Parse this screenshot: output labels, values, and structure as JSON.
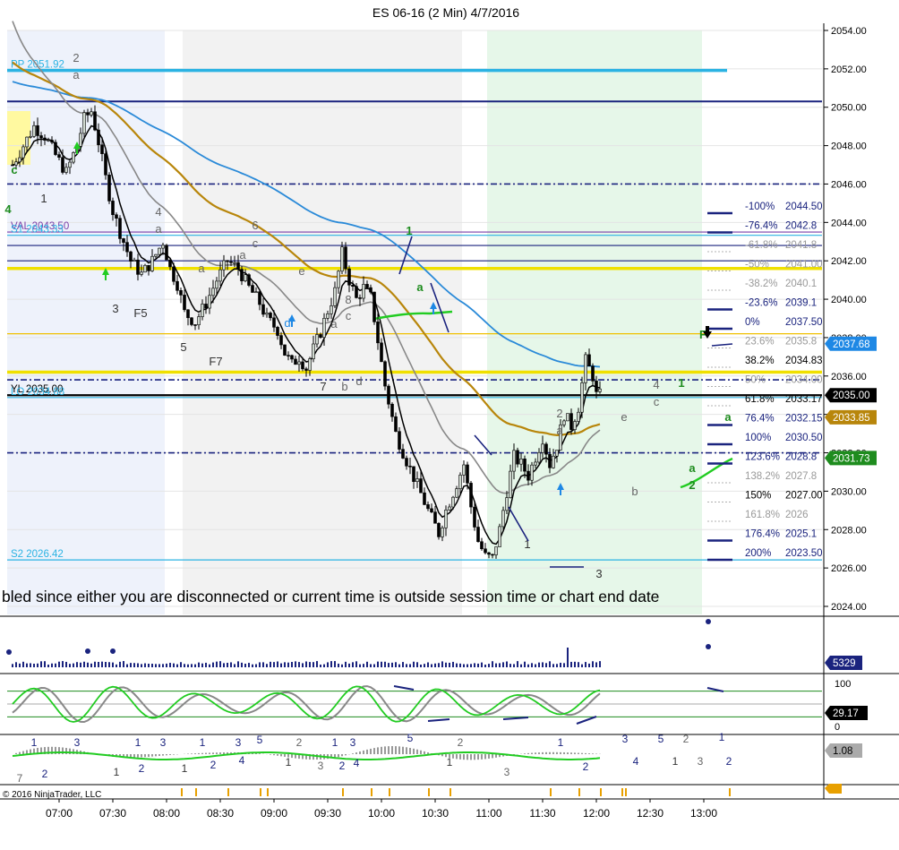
{
  "title": "ES 06-16 (2 Min)  4/7/2016",
  "copyright": "© 2016 NinjaTrader, LLC",
  "warning": "bled since either you are disconnected or current time is outside session time or chart end date",
  "chart_data": [
    {
      "type": "candlestick",
      "name": "price-panel",
      "ylim": [
        2024,
        2054
      ],
      "y_ticks": [
        "2054.00",
        "2052.00",
        "2050.00",
        "2048.00",
        "2046.00",
        "2044.00",
        "2042.00",
        "2040.00",
        "2038.00",
        "2036.00",
        "2034.00",
        "2032.00",
        "2030.00",
        "2028.00",
        "2026.00",
        "2024.00"
      ],
      "x_labels": [
        "07:00",
        "07:30",
        "08:00",
        "08:30",
        "09:00",
        "09:30",
        "10:00",
        "10:30",
        "11:00",
        "11:30",
        "12:00",
        "12:30",
        "13:00"
      ],
      "close_path": [
        [
          0,
          2047.0
        ],
        [
          3,
          2048.0
        ],
        [
          6,
          2049.0
        ],
        [
          9,
          2048.5
        ],
        [
          12,
          2047.5
        ],
        [
          15,
          2046.6
        ],
        [
          18,
          2048.0
        ],
        [
          20,
          2049.4
        ],
        [
          22,
          2049.8
        ],
        [
          24,
          2048.2
        ],
        [
          26,
          2046.3
        ],
        [
          28,
          2044.6
        ],
        [
          30,
          2043.5
        ],
        [
          31,
          2043.0
        ],
        [
          33,
          2042.0
        ],
        [
          36,
          2041.3
        ],
        [
          39,
          2042.0
        ],
        [
          42,
          2043.0
        ],
        [
          44,
          2041.6
        ],
        [
          46,
          2040.8
        ],
        [
          48,
          2039.3
        ],
        [
          51,
          2038.8
        ],
        [
          54,
          2039.8
        ],
        [
          57,
          2041.0
        ],
        [
          60,
          2042.0
        ],
        [
          63,
          2041.6
        ],
        [
          66,
          2040.6
        ],
        [
          69,
          2039.8
        ],
        [
          71,
          2039.0
        ],
        [
          74,
          2038.4
        ],
        [
          76,
          2037.2
        ],
        [
          78,
          2036.6
        ],
        [
          80,
          2037.0
        ],
        [
          82,
          2036.4
        ],
        [
          84,
          2037.4
        ],
        [
          86,
          2038.3
        ],
        [
          88,
          2039.4
        ],
        [
          90,
          2040.4
        ],
        [
          92,
          2042.4
        ],
        [
          94,
          2041.0
        ],
        [
          96,
          2040.0
        ],
        [
          98,
          2040.6
        ],
        [
          100,
          2040.1
        ],
        [
          101,
          2039.0
        ],
        [
          104,
          2035.5
        ],
        [
          107,
          2033.0
        ],
        [
          110,
          2031.6
        ],
        [
          113,
          2030.3
        ],
        [
          116,
          2029.0
        ],
        [
          119,
          2027.8
        ],
        [
          121,
          2029.0
        ],
        [
          124,
          2030.4
        ],
        [
          126,
          2031.4
        ],
        [
          128,
          2029.2
        ],
        [
          130,
          2027.4
        ],
        [
          132,
          2026.6
        ],
        [
          134,
          2026.5
        ],
        [
          136,
          2028.0
        ],
        [
          138,
          2030.0
        ],
        [
          140,
          2031.8
        ],
        [
          142,
          2031.4
        ],
        [
          144,
          2030.8
        ],
        [
          146,
          2031.8
        ],
        [
          148,
          2032.8
        ],
        [
          150,
          2031.4
        ],
        [
          152,
          2032.4
        ],
        [
          154,
          2034.0
        ],
        [
          156,
          2033.4
        ],
        [
          158,
          2034.4
        ],
        [
          160,
          2036.8
        ],
        [
          162,
          2036.0
        ],
        [
          163,
          2035.0
        ]
      ],
      "horizontal_levels": [
        {
          "label": "PP 2051.92",
          "price": 2051.92,
          "color": "#2bb3e3"
        },
        {
          "label": "",
          "price": 2050.3,
          "color": "#1a237e"
        },
        {
          "label": "",
          "price": 2046.0,
          "color": "#1a237e"
        },
        {
          "label": "VAL 2043.50",
          "price": 2043.5,
          "color": "#7b3fa8"
        },
        {
          "label": "S1 2043.33",
          "price": 2043.33,
          "color": "#2bb3e3"
        },
        {
          "label": "",
          "price": 2042.8,
          "color": "#1a237e"
        },
        {
          "label": "",
          "price": 2042.0,
          "color": "#1a237e"
        },
        {
          "label": "",
          "price": 2041.6,
          "color": "#f0e000"
        },
        {
          "label": "",
          "price": 2038.2,
          "color": "#f0c000"
        },
        {
          "label": "",
          "price": 2036.2,
          "color": "#f0e000"
        },
        {
          "label": "",
          "price": 2035.8,
          "color": "#1a237e"
        },
        {
          "label": "YL 2035.00",
          "price": 2035.0,
          "color": "#000000"
        },
        {
          "label": "LO 2034.88",
          "price": 2034.88,
          "color": "#2bb3e3"
        },
        {
          "label": "",
          "price": 2032.0,
          "color": "#1a237e"
        },
        {
          "label": "S2 2026.42",
          "price": 2026.42,
          "color": "#2bb3e3"
        }
      ],
      "fib_levels": [
        {
          "label": "-100%",
          "value": "2044.50",
          "color": "#1a237e"
        },
        {
          "label": "-76.4%",
          "value": "2042.8",
          "color": "#1a237e"
        },
        {
          "label": "-61.8%",
          "value": "2041.8",
          "color": "#999999"
        },
        {
          "label": "-50%",
          "value": "2041.00",
          "color": "#999999"
        },
        {
          "label": "-38.2%",
          "value": "2040.1",
          "color": "#999999"
        },
        {
          "label": "-23.6%",
          "value": "2039.1",
          "color": "#1a237e"
        },
        {
          "label": "0%",
          "value": "2037.50",
          "color": "#1a237e"
        },
        {
          "label": "23.6%",
          "value": "2035.8",
          "color": "#999999"
        },
        {
          "label": "38.2%",
          "value": "2034.83",
          "color": "#000000"
        },
        {
          "label": "50%",
          "value": "2034.00",
          "color": "#999999"
        },
        {
          "label": "61.8%",
          "value": "2033.17",
          "color": "#000000"
        },
        {
          "label": "76.4%",
          "value": "2032.15",
          "color": "#1a237e"
        },
        {
          "label": "100%",
          "value": "2030.50",
          "color": "#1a237e"
        },
        {
          "label": "123.6%",
          "value": "2028.8",
          "color": "#1a237e"
        },
        {
          "label": "138.2%",
          "value": "2027.8",
          "color": "#999999"
        },
        {
          "label": "150%",
          "value": "2027.00",
          "color": "#000000"
        },
        {
          "label": "161.8%",
          "value": "2026",
          "color": "#999999"
        },
        {
          "label": "176.4%",
          "value": "2025.1",
          "color": "#1a237e"
        },
        {
          "label": "200%",
          "value": "2023.50",
          "color": "#1a237e"
        }
      ],
      "price_tags": [
        {
          "label": "2037.68",
          "price": 2037.68,
          "bg": "#1e88e5",
          "fg": "#ffffff"
        },
        {
          "label": "2035.00",
          "price": 2035.0,
          "bg": "#000000",
          "fg": "#ffffff"
        },
        {
          "label": "2033.85",
          "price": 2033.85,
          "bg": "#b8860b",
          "fg": "#ffffff"
        },
        {
          "label": "2031.73",
          "price": 2031.73,
          "bg": "#1e8c1e",
          "fg": "#ffffff"
        }
      ],
      "wave_labels": [
        {
          "text": "2",
          "x": 85,
          "y": 69,
          "color": "#666666"
        },
        {
          "text": "a",
          "x": 85,
          "y": 88,
          "color": "#666666"
        },
        {
          "text": "1",
          "x": 49,
          "y": 226,
          "color": "#333333"
        },
        {
          "text": "c",
          "x": 16,
          "y": 194,
          "color": "#1e8c1e"
        },
        {
          "text": "4",
          "x": 9,
          "y": 238,
          "color": "#1e8c1e"
        },
        {
          "text": "4",
          "x": 177,
          "y": 241,
          "color": "#666666"
        },
        {
          "text": "a",
          "x": 177,
          "y": 260,
          "color": "#666666"
        },
        {
          "text": "3",
          "x": 129,
          "y": 349,
          "color": "#333333"
        },
        {
          "text": "F5",
          "x": 157,
          "y": 354,
          "color": "#333333"
        },
        {
          "text": "a",
          "x": 225,
          "y": 304,
          "color": "#666666"
        },
        {
          "text": "5",
          "x": 205,
          "y": 392,
          "color": "#333333"
        },
        {
          "text": "F7",
          "x": 241,
          "y": 408,
          "color": "#333333"
        },
        {
          "text": "6",
          "x": 285,
          "y": 256,
          "color": "#666666"
        },
        {
          "text": "c",
          "x": 285,
          "y": 276,
          "color": "#666666"
        },
        {
          "text": "a",
          "x": 271,
          "y": 289,
          "color": "#666666"
        },
        {
          "text": "e",
          "x": 337,
          "y": 307,
          "color": "#666666"
        },
        {
          "text": "d",
          "x": 321,
          "y": 365,
          "color": "#1e88e5"
        },
        {
          "text": "8",
          "x": 389,
          "y": 339,
          "color": "#666666"
        },
        {
          "text": "c",
          "x": 389,
          "y": 357,
          "color": "#666666"
        },
        {
          "text": "a",
          "x": 373,
          "y": 366,
          "color": "#666666"
        },
        {
          "text": "7",
          "x": 361,
          "y": 436,
          "color": "#333333"
        },
        {
          "text": "b",
          "x": 385,
          "y": 436,
          "color": "#666666"
        },
        {
          "text": "d",
          "x": 401,
          "y": 430,
          "color": "#666666"
        },
        {
          "text": "1",
          "x": 457,
          "y": 262,
          "color": "#1e8c1e"
        },
        {
          "text": "a",
          "x": 469,
          "y": 325,
          "color": "#1e8c1e"
        },
        {
          "text": "2",
          "x": 625,
          "y": 466,
          "color": "#666666"
        },
        {
          "text": "a",
          "x": 625,
          "y": 485,
          "color": "#666666"
        },
        {
          "text": "1",
          "x": 589,
          "y": 612,
          "color": "#333333"
        },
        {
          "text": "3",
          "x": 669,
          "y": 645,
          "color": "#333333"
        },
        {
          "text": "e",
          "x": 697,
          "y": 470,
          "color": "#666666"
        },
        {
          "text": "4",
          "x": 733,
          "y": 434,
          "color": "#666666"
        },
        {
          "text": "c",
          "x": 733,
          "y": 453,
          "color": "#666666"
        },
        {
          "text": "b",
          "x": 709,
          "y": 553,
          "color": "#666666"
        },
        {
          "text": "1",
          "x": 761,
          "y": 432,
          "color": "#1e8c1e"
        },
        {
          "text": "a",
          "x": 773,
          "y": 527,
          "color": "#1e8c1e"
        },
        {
          "text": "2",
          "x": 773,
          "y": 546,
          "color": "#1e8c1e"
        },
        {
          "text": "F",
          "x": 785,
          "y": 378,
          "color": "#1e8c1e"
        },
        {
          "text": "a",
          "x": 813,
          "y": 470,
          "color": "#1e8c1e"
        }
      ]
    },
    {
      "type": "bar",
      "name": "volume-panel",
      "ylim": [
        0,
        1
      ],
      "current": "5329"
    },
    {
      "type": "line",
      "name": "stochastic-panel",
      "ylim": [
        0,
        100
      ],
      "y_ticks": [
        "100",
        "0"
      ],
      "current": "29.17"
    },
    {
      "type": "bar",
      "name": "macd-panel",
      "current": "1.08",
      "wave_labels": [
        {
          "text": "1",
          "x": 38,
          "y": 833,
          "color": "#1a237e"
        },
        {
          "text": "3",
          "x": 86,
          "y": 833,
          "color": "#1a237e"
        },
        {
          "text": "7",
          "x": 22,
          "y": 873,
          "color": "#666666"
        },
        {
          "text": "2",
          "x": 50,
          "y": 868,
          "color": "#1a237e"
        },
        {
          "text": "1",
          "x": 130,
          "y": 866,
          "color": "#333333"
        },
        {
          "text": "1",
          "x": 154,
          "y": 833,
          "color": "#1a237e"
        },
        {
          "text": "3",
          "x": 182,
          "y": 833,
          "color": "#1a237e"
        },
        {
          "text": "2",
          "x": 158,
          "y": 862,
          "color": "#1a237e"
        },
        {
          "text": "1",
          "x": 206,
          "y": 862,
          "color": "#333333"
        },
        {
          "text": "1",
          "x": 226,
          "y": 833,
          "color": "#1a237e"
        },
        {
          "text": "2",
          "x": 238,
          "y": 858,
          "color": "#1a237e"
        },
        {
          "text": "3",
          "x": 266,
          "y": 833,
          "color": "#1a237e"
        },
        {
          "text": "5",
          "x": 290,
          "y": 830,
          "color": "#1a237e"
        },
        {
          "text": "4",
          "x": 270,
          "y": 853,
          "color": "#1a237e"
        },
        {
          "text": "1",
          "x": 322,
          "y": 855,
          "color": "#333333"
        },
        {
          "text": "2",
          "x": 334,
          "y": 833,
          "color": "#666666"
        },
        {
          "text": "3",
          "x": 358,
          "y": 859,
          "color": "#666666"
        },
        {
          "text": "1",
          "x": 374,
          "y": 833,
          "color": "#1a237e"
        },
        {
          "text": "3",
          "x": 394,
          "y": 833,
          "color": "#1a237e"
        },
        {
          "text": "2",
          "x": 382,
          "y": 859,
          "color": "#1a237e"
        },
        {
          "text": "4",
          "x": 398,
          "y": 856,
          "color": "#1a237e"
        },
        {
          "text": "5",
          "x": 458,
          "y": 828,
          "color": "#1a237e"
        },
        {
          "text": "1",
          "x": 502,
          "y": 855,
          "color": "#333333"
        },
        {
          "text": "2",
          "x": 514,
          "y": 833,
          "color": "#666666"
        },
        {
          "text": "3",
          "x": 566,
          "y": 866,
          "color": "#666666"
        },
        {
          "text": "1",
          "x": 626,
          "y": 833,
          "color": "#1a237e"
        },
        {
          "text": "2",
          "x": 654,
          "y": 860,
          "color": "#1a237e"
        },
        {
          "text": "3",
          "x": 698,
          "y": 829,
          "color": "#1a237e"
        },
        {
          "text": "4",
          "x": 710,
          "y": 854,
          "color": "#1a237e"
        },
        {
          "text": "5",
          "x": 738,
          "y": 829,
          "color": "#1a237e"
        },
        {
          "text": "1",
          "x": 754,
          "y": 854,
          "color": "#333333"
        },
        {
          "text": "2",
          "x": 766,
          "y": 829,
          "color": "#666666"
        },
        {
          "text": "3",
          "x": 782,
          "y": 854,
          "color": "#666666"
        },
        {
          "text": "1",
          "x": 806,
          "y": 827,
          "color": "#1a237e"
        },
        {
          "text": "2",
          "x": 814,
          "y": 854,
          "color": "#1a237e"
        }
      ]
    }
  ]
}
